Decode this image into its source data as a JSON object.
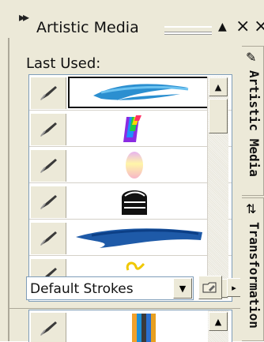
{
  "panel": {
    "title": "Artistic Media",
    "title_arrows": "▸▸",
    "collapse_glyph": "▲",
    "close_glyph": "×",
    "close2_glyph": "×"
  },
  "last_used": {
    "label": "Last Used:",
    "rows": [
      {
        "stroke": "blue-scribble",
        "selected": true
      },
      {
        "stroke": "rainbow-ribbon",
        "selected": false
      },
      {
        "stroke": "pastel-gradient",
        "selected": false
      },
      {
        "stroke": "black-arch",
        "selected": false
      },
      {
        "stroke": "blue-brush",
        "selected": false
      },
      {
        "stroke": "yellow-curl",
        "selected": false
      }
    ]
  },
  "strokes": {
    "category_value": "Default Strokes",
    "dropdown_glyph": "▼",
    "flyout_glyph": "▸"
  },
  "tabs": [
    {
      "label": "Artistic Media",
      "icon": "brush-icon"
    },
    {
      "label": "Transformation",
      "icon": "transform-icon"
    }
  ],
  "colors": {
    "panel": "#ece9d8",
    "selection_border": "#111111",
    "list_border": "#7f9db9"
  }
}
